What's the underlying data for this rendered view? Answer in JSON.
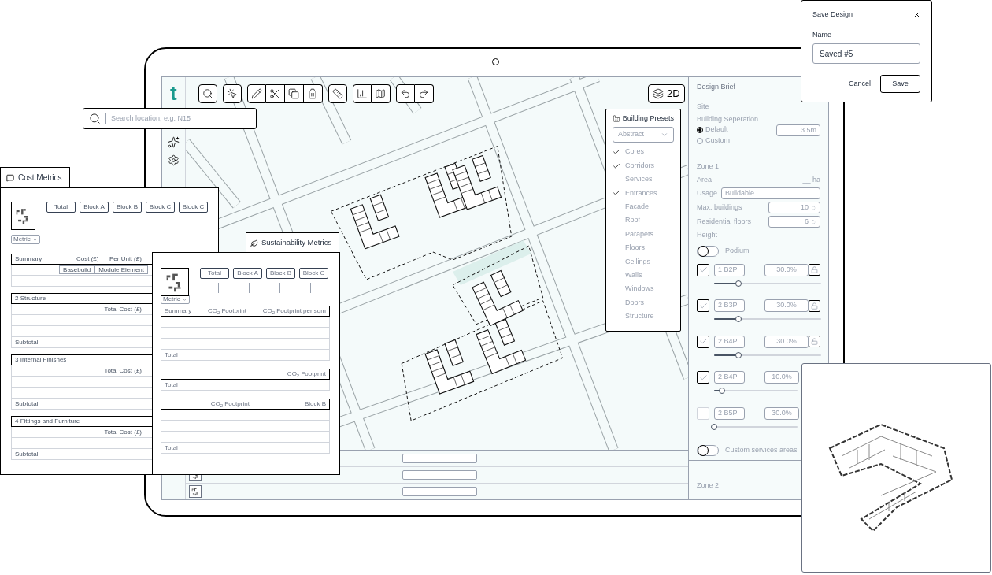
{
  "save_dialog": {
    "title": "Save Design",
    "name_label": "Name",
    "name_value": "Saved #5",
    "buttons": [
      "Cancel",
      "Save"
    ]
  },
  "search": {
    "placeholder": "Search location, e.g. N15"
  },
  "app": {
    "logo": "t",
    "view_button": "2D",
    "building_presets": {
      "title": "Building Presets",
      "dropdown": "Abstract",
      "items": [
        {
          "label": "Cores",
          "checked": true
        },
        {
          "label": "Corridors",
          "checked": true
        },
        {
          "label": "Services",
          "checked": false
        },
        {
          "label": "Entrances",
          "checked": true
        },
        {
          "label": "Facade",
          "checked": false
        },
        {
          "label": "Roof",
          "checked": false
        },
        {
          "label": "Parapets",
          "checked": false
        },
        {
          "label": "Floors",
          "checked": false
        },
        {
          "label": "Ceilings",
          "checked": false
        },
        {
          "label": "Walls",
          "checked": false
        },
        {
          "label": "Windows",
          "checked": false
        },
        {
          "label": "Doors",
          "checked": false
        },
        {
          "label": "Structure",
          "checked": false
        }
      ]
    },
    "design_brief": {
      "title": "Design Brief",
      "site": {
        "heading": "Site",
        "label": "Building Seperation",
        "options": [
          {
            "label": "Default",
            "selected": true
          },
          {
            "label": "Custom",
            "selected": false
          }
        ],
        "value": "3.5m"
      },
      "zone": {
        "title": "Zone 1",
        "area_label": "Area",
        "area_value": "__ ha",
        "usage_label": "Usage",
        "usage_value": "Buildable",
        "max_label": "Max. buildings",
        "max_value": "10",
        "floors_label": "Residential floors",
        "floors_value": "6",
        "height_label": "Height",
        "podium": {
          "label": "Podium",
          "on": false
        },
        "units": [
          {
            "checked": true,
            "name": "1 B2P",
            "share": "30.0%",
            "level": 0.23,
            "locked": true
          },
          {
            "checked": true,
            "name": "2 B3P",
            "share": "30.0%",
            "level": 0.23,
            "locked": false
          },
          {
            "checked": true,
            "name": "2 B4P",
            "share": "30.0%",
            "level": 0.23,
            "locked": false
          },
          {
            "checked": true,
            "name": "2 B4P",
            "share": "10.0%",
            "level": 0.09
          },
          {
            "checked": false,
            "name": "2 B5P",
            "share": "30.0%",
            "level": 0
          }
        ],
        "services": {
          "label": "Custom services areas",
          "on": false
        }
      },
      "next_zone": "Zone 2"
    }
  },
  "cost_metrics": {
    "title": "Cost Metrics",
    "blocks": [
      "Total",
      "Block A",
      "Block B",
      "Block C",
      "Block C"
    ],
    "metric": "Metric",
    "summary_columns": [
      "Summary",
      "Cost (£)",
      "Per Unit (£)"
    ],
    "sub_buttons": [
      "Basebuild",
      "Module Element"
    ],
    "sections": [
      {
        "title": "2 Structure",
        "total_label": "Total Cost (£)",
        "subtotal": "Subtotal"
      },
      {
        "title": "3 Internal Finishes",
        "total_label": "Total Cost (£)",
        "subtotal": "Subtotal"
      },
      {
        "title": "4 Fittings and Furniture",
        "total_label": "Total Cost (£)",
        "subtotal": "Subtotal"
      }
    ]
  },
  "sustainability_metrics": {
    "title": "Sustainability Metrics",
    "blocks": [
      "Total",
      "Block A",
      "Block B",
      "Block C"
    ],
    "metric": "Metric",
    "tables": [
      {
        "columns": [
          "Summary",
          "CO$_{2}$ Footprint",
          "CO$_{2}$ Footprint per sqm"
        ],
        "total": "Total"
      },
      {
        "columns": [
          "CO$_{2}$ Footprint"
        ],
        "total": "Total"
      },
      {
        "columns": [
          "CO$_{2}$ Footprint",
          "Block B"
        ],
        "total": "Total"
      }
    ]
  }
}
